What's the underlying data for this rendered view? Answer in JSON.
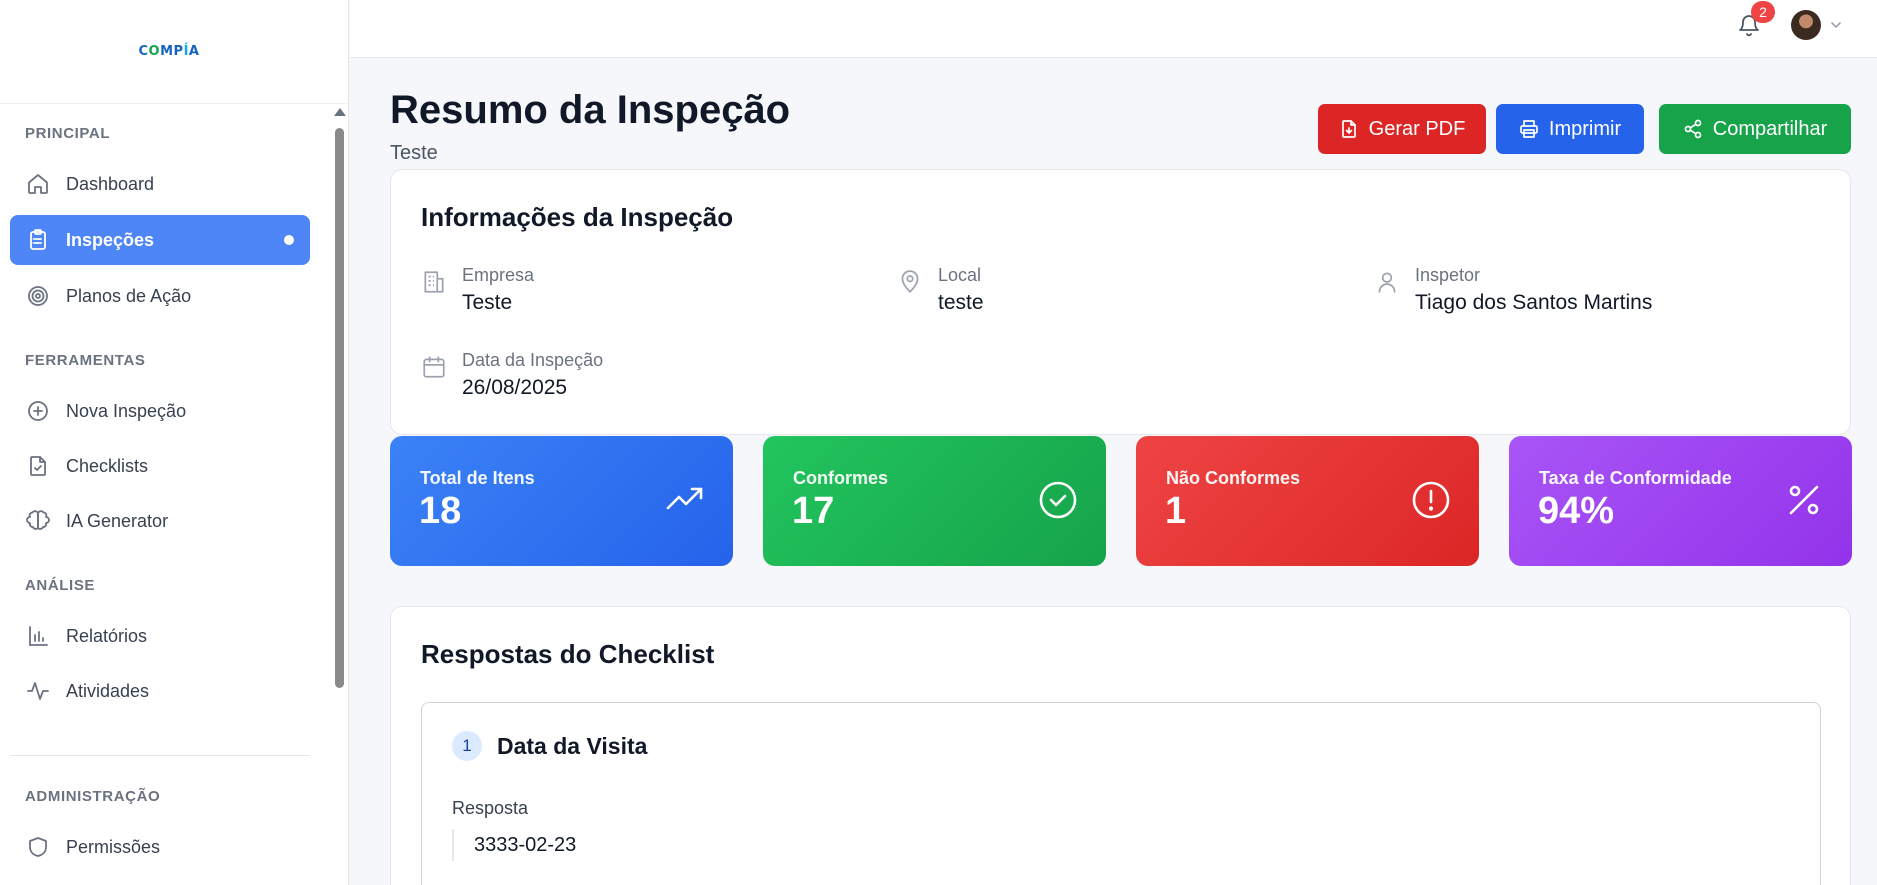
{
  "app": {
    "logo": {
      "c": "C",
      "o": "O",
      "mp": "MP",
      "i": "Í",
      "a": "A"
    }
  },
  "sidebar": {
    "sections": {
      "principal": "PRINCIPAL",
      "ferramentas": "FERRAMENTAS",
      "analise": "ANÁLISE",
      "administracao": "ADMINISTRAÇÃO"
    },
    "items": [
      {
        "label": "Dashboard",
        "icon": "home-icon",
        "active": false
      },
      {
        "label": "Inspeções",
        "icon": "clipboard-icon",
        "active": true
      },
      {
        "label": "Planos de Ação",
        "icon": "target-icon",
        "active": false
      },
      {
        "label": "Nova Inspeção",
        "icon": "plus-circle-icon",
        "active": false
      },
      {
        "label": "Checklists",
        "icon": "file-check-icon",
        "active": false
      },
      {
        "label": "IA Generator",
        "icon": "brain-icon",
        "active": false
      },
      {
        "label": "Relatórios",
        "icon": "bar-chart-icon",
        "active": false
      },
      {
        "label": "Atividades",
        "icon": "activity-icon",
        "active": false
      },
      {
        "label": "Permissões",
        "icon": "shield-icon",
        "active": false
      }
    ]
  },
  "topbar": {
    "notifications_count": "2"
  },
  "page": {
    "title": "Resumo da Inspeção",
    "subtitle": "Teste",
    "actions": {
      "pdf": "Gerar PDF",
      "print": "Imprimir",
      "share": "Compartilhar"
    }
  },
  "info": {
    "title": "Informações da Inspeção",
    "empresa": {
      "label": "Empresa",
      "value": "Teste"
    },
    "local": {
      "label": "Local",
      "value": "teste"
    },
    "inspetor": {
      "label": "Inspetor",
      "value": "Tiago dos Santos Martins"
    },
    "data": {
      "label": "Data da Inspeção",
      "value": "26/08/2025"
    }
  },
  "stats": {
    "total": {
      "label": "Total de Itens",
      "value": "18"
    },
    "conformes": {
      "label": "Conformes",
      "value": "17"
    },
    "nao_conformes": {
      "label": "Não Conformes",
      "value": "1"
    },
    "taxa": {
      "label": "Taxa de Conformidade",
      "value": "94%"
    }
  },
  "responses": {
    "title": "Respostas do Checklist",
    "items": [
      {
        "number": "1",
        "title": "Data da Visita",
        "answer_label": "Resposta",
        "answer": "3333-02-23"
      }
    ]
  },
  "colors": {
    "primary": "#2563eb",
    "active_nav": "#4f86f7",
    "success": "#16a34a",
    "danger": "#dc2626",
    "purple": "#9333ea",
    "badge": "#ef4444"
  }
}
